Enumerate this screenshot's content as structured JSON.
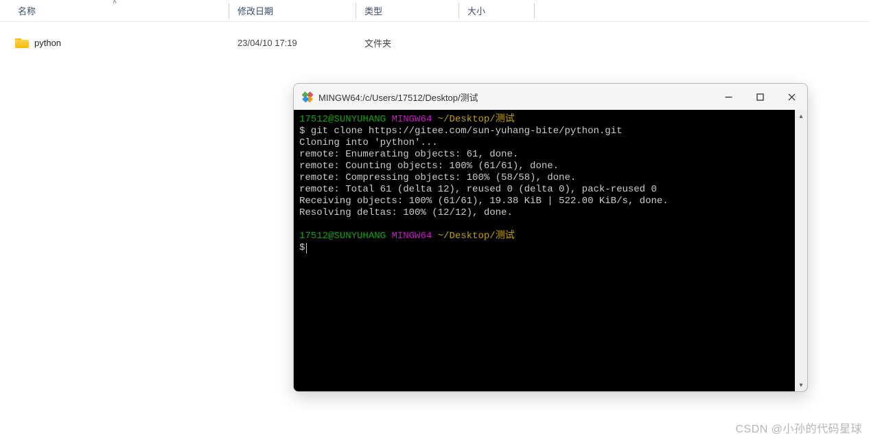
{
  "explorer": {
    "columns": {
      "name": "名称",
      "date": "修改日期",
      "type": "类型",
      "size": "大小"
    },
    "rows": [
      {
        "name": "python",
        "date": "23/04/10 17:19",
        "type": "文件夹",
        "size": ""
      }
    ]
  },
  "terminal": {
    "title": "MINGW64:/c/Users/17512/Desktop/测试",
    "prompt1": {
      "user": "17512@SUNYUHANG",
      "env": "MINGW64",
      "path": "~/Desktop/测试"
    },
    "command": "$ git clone https://gitee.com/sun-yuhang-bite/python.git",
    "output_lines": [
      "Cloning into 'python'...",
      "remote: Enumerating objects: 61, done.",
      "remote: Counting objects: 100% (61/61), done.",
      "remote: Compressing objects: 100% (58/58), done.",
      "remote: Total 61 (delta 12), reused 0 (delta 0), pack-reused 0",
      "Receiving objects: 100% (61/61), 19.38 KiB | 522.00 KiB/s, done.",
      "Resolving deltas: 100% (12/12), done."
    ],
    "prompt2": {
      "user": "17512@SUNYUHANG",
      "env": "MINGW64",
      "path": "~/Desktop/测试"
    },
    "prompt2_sym": "$"
  },
  "watermark": "CSDN @小孙的代码星球"
}
